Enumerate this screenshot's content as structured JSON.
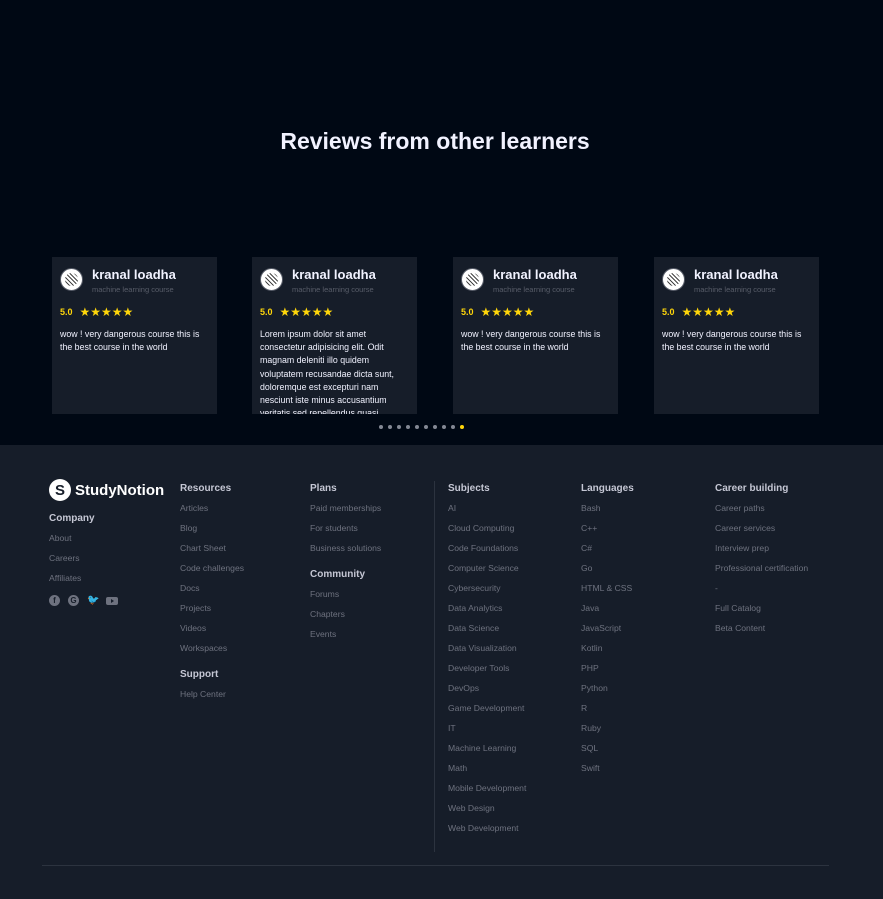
{
  "reviews": {
    "title": "Reviews from other learners",
    "cards": [
      {
        "name": "kranal loadha",
        "course": "machine learning course",
        "rating": "5.0",
        "stars": "★★★★★",
        "text": "wow ! very dangerous course this is the best course in the world"
      },
      {
        "name": "kranal loadha",
        "course": "machine learning course",
        "rating": "5.0",
        "stars": "★★★★★",
        "text": "Lorem ipsum dolor sit amet consectetur adipisicing elit. Odit magnam deleniti illo quidem voluptatem recusandae dicta sunt, doloremque est excepturi nam nesciunt iste minus accusantium veritatis sed repellendus quasi"
      },
      {
        "name": "kranal loadha",
        "course": "machine learning course",
        "rating": "5.0",
        "stars": "★★★★★",
        "text": "wow ! very dangerous course this is the best course in the world"
      },
      {
        "name": "kranal loadha",
        "course": "machine learning course",
        "rating": "5.0",
        "stars": "★★★★★",
        "text": "wow ! very dangerous course this is the best course in the world"
      }
    ],
    "pagination": {
      "total": 10,
      "active_index": 9
    }
  },
  "footer": {
    "brand": {
      "mark": "S",
      "name": "StudyNotion"
    },
    "company": {
      "title": "Company",
      "items": [
        "About",
        "Careers",
        "Affiliates"
      ]
    },
    "socials": [
      "facebook-icon",
      "google-icon",
      "twitter-icon",
      "youtube-icon"
    ],
    "resources": {
      "title": "Resources",
      "items": [
        "Articles",
        "Blog",
        "Chart Sheet",
        "Code challenges",
        "Docs",
        "Projects",
        "Videos",
        "Workspaces"
      ]
    },
    "support": {
      "title": "Support",
      "items": [
        "Help Center"
      ]
    },
    "plans": {
      "title": "Plans",
      "items": [
        "Paid memberships",
        "For students",
        "Business solutions"
      ]
    },
    "community": {
      "title": "Community",
      "items": [
        "Forums",
        "Chapters",
        "Events"
      ]
    },
    "subjects": {
      "title": "Subjects",
      "items": [
        "AI",
        "Cloud Computing",
        "Code Foundations",
        "Computer Science",
        "Cybersecurity",
        "Data Analytics",
        "Data Science",
        "Data Visualization",
        "Developer Tools",
        "DevOps",
        "Game Development",
        "IT",
        "Machine Learning",
        "Math",
        "Mobile Development",
        "Web Design",
        "Web Development"
      ]
    },
    "languages": {
      "title": "Languages",
      "items": [
        "Bash",
        "C++",
        "C#",
        "Go",
        "HTML & CSS",
        "Java",
        "JavaScript",
        "Kotlin",
        "PHP",
        "Python",
        "R",
        "Ruby",
        "SQL",
        "Swift"
      ]
    },
    "career": {
      "title": "Career building",
      "items": [
        "Career paths",
        "Career services",
        "Interview prep",
        "Professional certification",
        "-",
        "Full Catalog",
        "Beta Content"
      ]
    }
  },
  "colors": {
    "background": "#000814",
    "card": "#161d29",
    "star": "#ffd60a",
    "footer": "#161d29",
    "link": "#6e727f"
  }
}
